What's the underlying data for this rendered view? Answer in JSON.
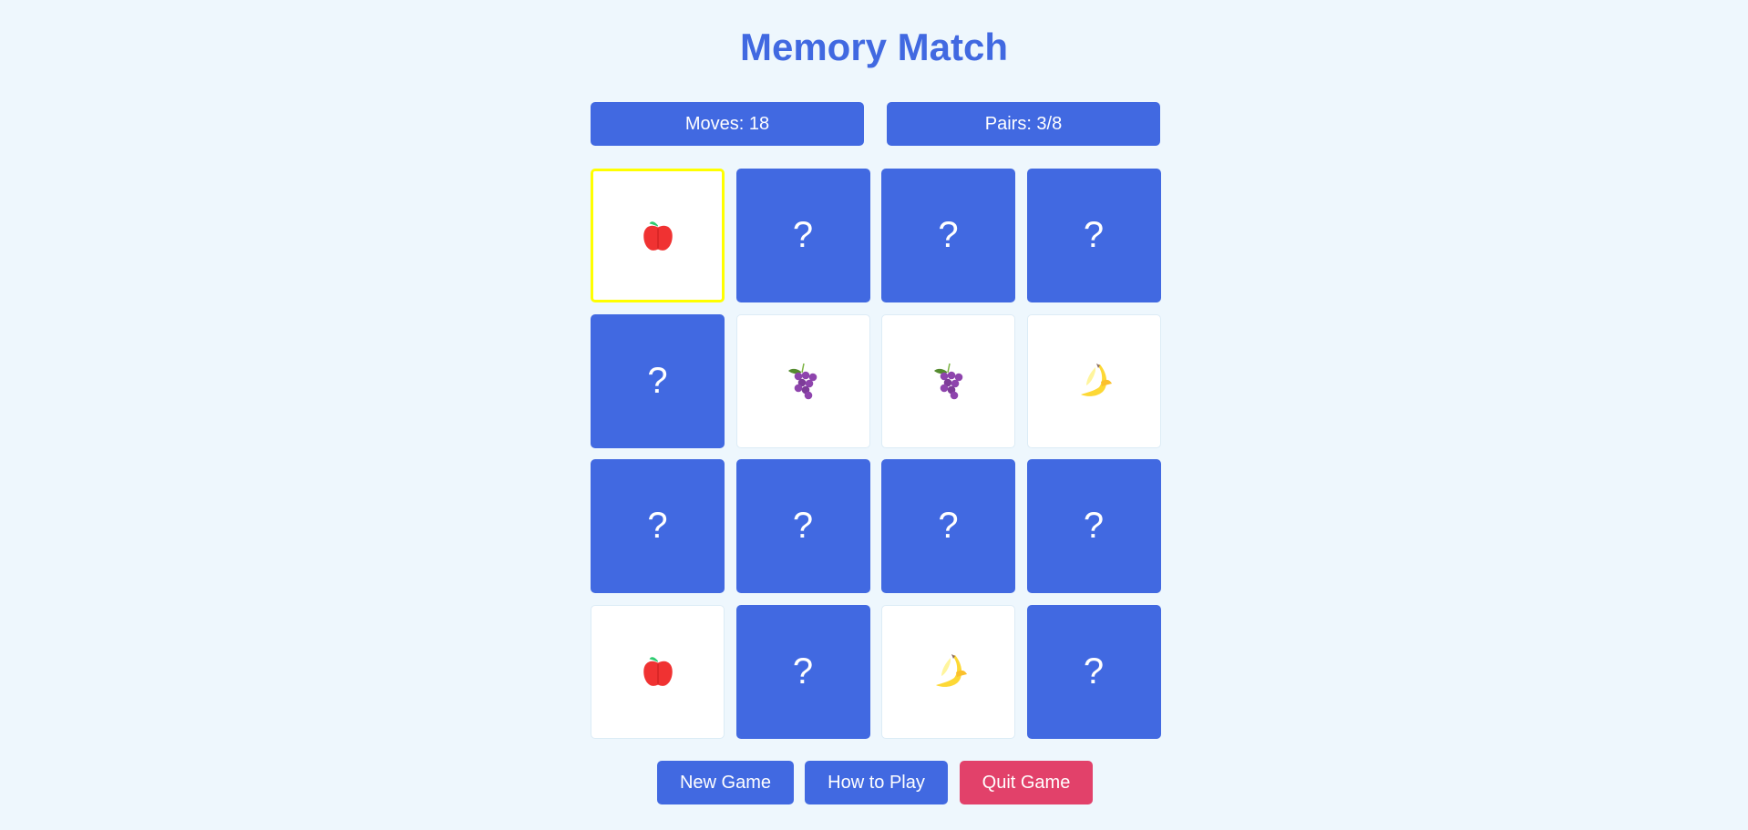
{
  "title": "Memory Match",
  "stats": {
    "moves": "Moves: 18",
    "pairs": "Pairs: 3/8"
  },
  "hidden_symbol": "?",
  "cards": [
    {
      "state": "revealed",
      "fruit": "apple-icon",
      "selected": true
    },
    {
      "state": "hidden"
    },
    {
      "state": "hidden"
    },
    {
      "state": "hidden"
    },
    {
      "state": "hidden"
    },
    {
      "state": "revealed",
      "fruit": "grapes-icon"
    },
    {
      "state": "revealed",
      "fruit": "grapes-icon"
    },
    {
      "state": "revealed",
      "fruit": "banana-icon"
    },
    {
      "state": "hidden"
    },
    {
      "state": "hidden"
    },
    {
      "state": "hidden"
    },
    {
      "state": "hidden"
    },
    {
      "state": "revealed",
      "fruit": "apple-icon"
    },
    {
      "state": "hidden"
    },
    {
      "state": "revealed",
      "fruit": "banana-icon"
    },
    {
      "state": "hidden"
    }
  ],
  "buttons": {
    "new_game": "New Game",
    "how_to_play": "How to Play",
    "quit_game": "Quit Game"
  },
  "colors": {
    "accent": "#4169e1",
    "background": "#eef7fd",
    "quit": "#e2416a",
    "selected_border": "#ffff00"
  }
}
